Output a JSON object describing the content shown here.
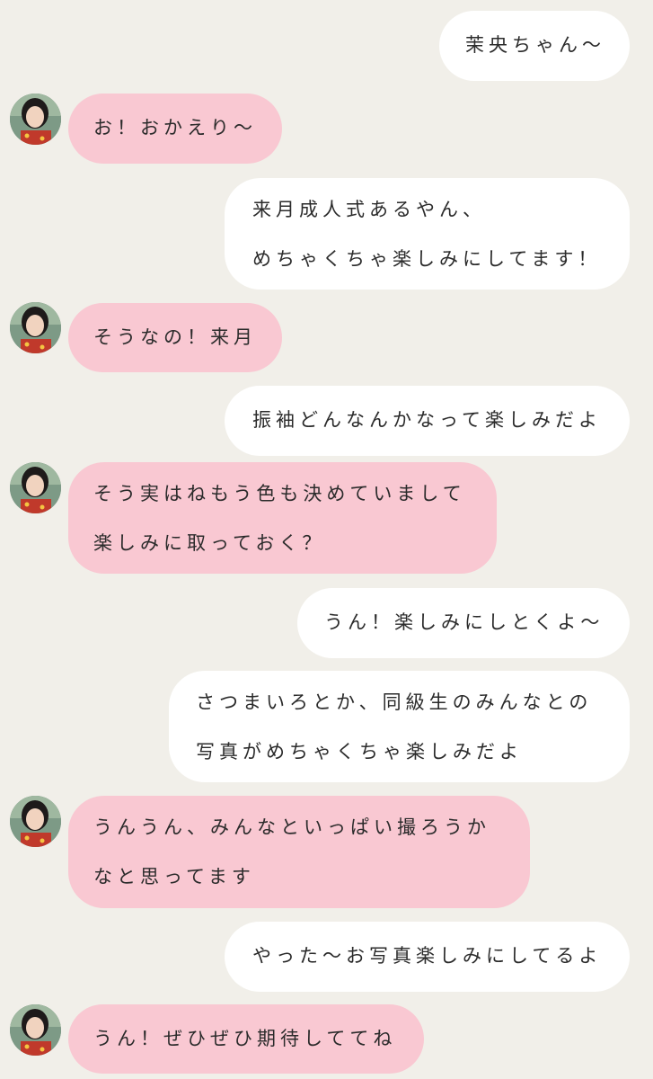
{
  "chat": {
    "colors": {
      "background": "#f1efe9",
      "sent_bubble": "#ffffff",
      "received_bubble": "#f9c8d2",
      "text": "#2b2b2b"
    },
    "messages": [
      {
        "side": "sent",
        "lines": [
          "茉央ちゃん〜"
        ]
      },
      {
        "side": "received",
        "avatar": "contact-avatar",
        "lines": [
          "お！おかえり〜"
        ]
      },
      {
        "side": "sent",
        "lines": [
          "来月成人式あるやん、",
          "めちゃくちゃ楽しみにしてます！"
        ]
      },
      {
        "side": "received",
        "avatar": "contact-avatar",
        "lines": [
          "そうなの！来月"
        ]
      },
      {
        "side": "sent",
        "lines": [
          "振袖どんなんかなって楽しみだよ"
        ]
      },
      {
        "side": "received",
        "avatar": "contact-avatar",
        "lines": [
          "そう実はねもう色も決めていまして",
          "楽しみに取っておく？"
        ]
      },
      {
        "side": "sent",
        "lines": [
          "うん！楽しみにしとくよ〜"
        ]
      },
      {
        "side": "sent",
        "lines": [
          "さつまいろとか、同級生のみんなとの",
          "写真がめちゃくちゃ楽しみだよ"
        ]
      },
      {
        "side": "received",
        "avatar": "contact-avatar",
        "lines": [
          "うんうん、みんなといっぱい撮ろうか",
          "なと思ってます"
        ]
      },
      {
        "side": "sent",
        "lines": [
          "やった〜お写真楽しみにしてるよ"
        ]
      },
      {
        "side": "received",
        "avatar": "contact-avatar",
        "lines": [
          "うん！ぜひぜひ期待しててね"
        ]
      }
    ]
  }
}
